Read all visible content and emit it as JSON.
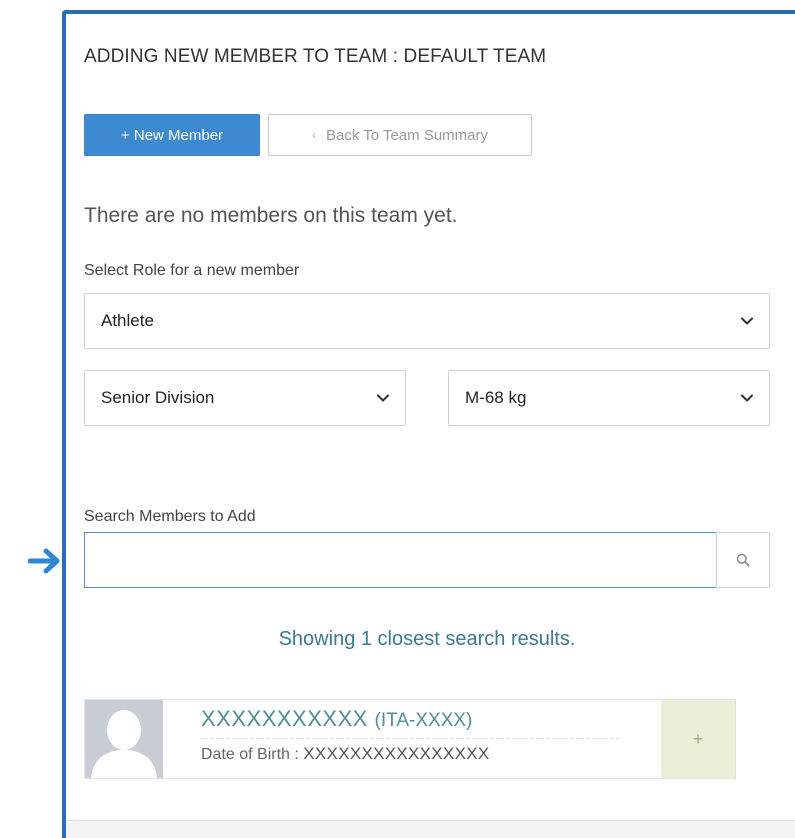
{
  "colors": {
    "accent": "#2a6db0",
    "primary_button": "#3e8ad0",
    "result_text": "#3a7a92",
    "add_button_bg": "#e8f0d8"
  },
  "page": {
    "title": "ADDING NEW MEMBER TO TEAM : DEFAULT TEAM"
  },
  "buttons": {
    "new_member": "+ New Member",
    "back_chevron": "‹",
    "back": "Back To Team Summary"
  },
  "messages": {
    "empty": "There are no members on this team yet.",
    "results": "Showing 1 closest search results."
  },
  "role": {
    "label": "Select Role for a new member",
    "selected": "Athlete"
  },
  "division": {
    "selected": "Senior Division"
  },
  "weight": {
    "selected": "M-68 kg"
  },
  "search": {
    "label": "Search Members to Add",
    "value": "",
    "placeholder": ""
  },
  "result": {
    "name": "XXXXXXXXXXX",
    "code": "(ITA-XXXX)",
    "dob_label": "Date of Birth :",
    "dob_value": "XXXXXXXXXXXXXXXX",
    "add_label": "+"
  },
  "icons": {
    "arrow": "arrow-right-icon",
    "caret": "chevron-down-icon",
    "search": "search-icon",
    "avatar": "user-silhouette-icon"
  }
}
